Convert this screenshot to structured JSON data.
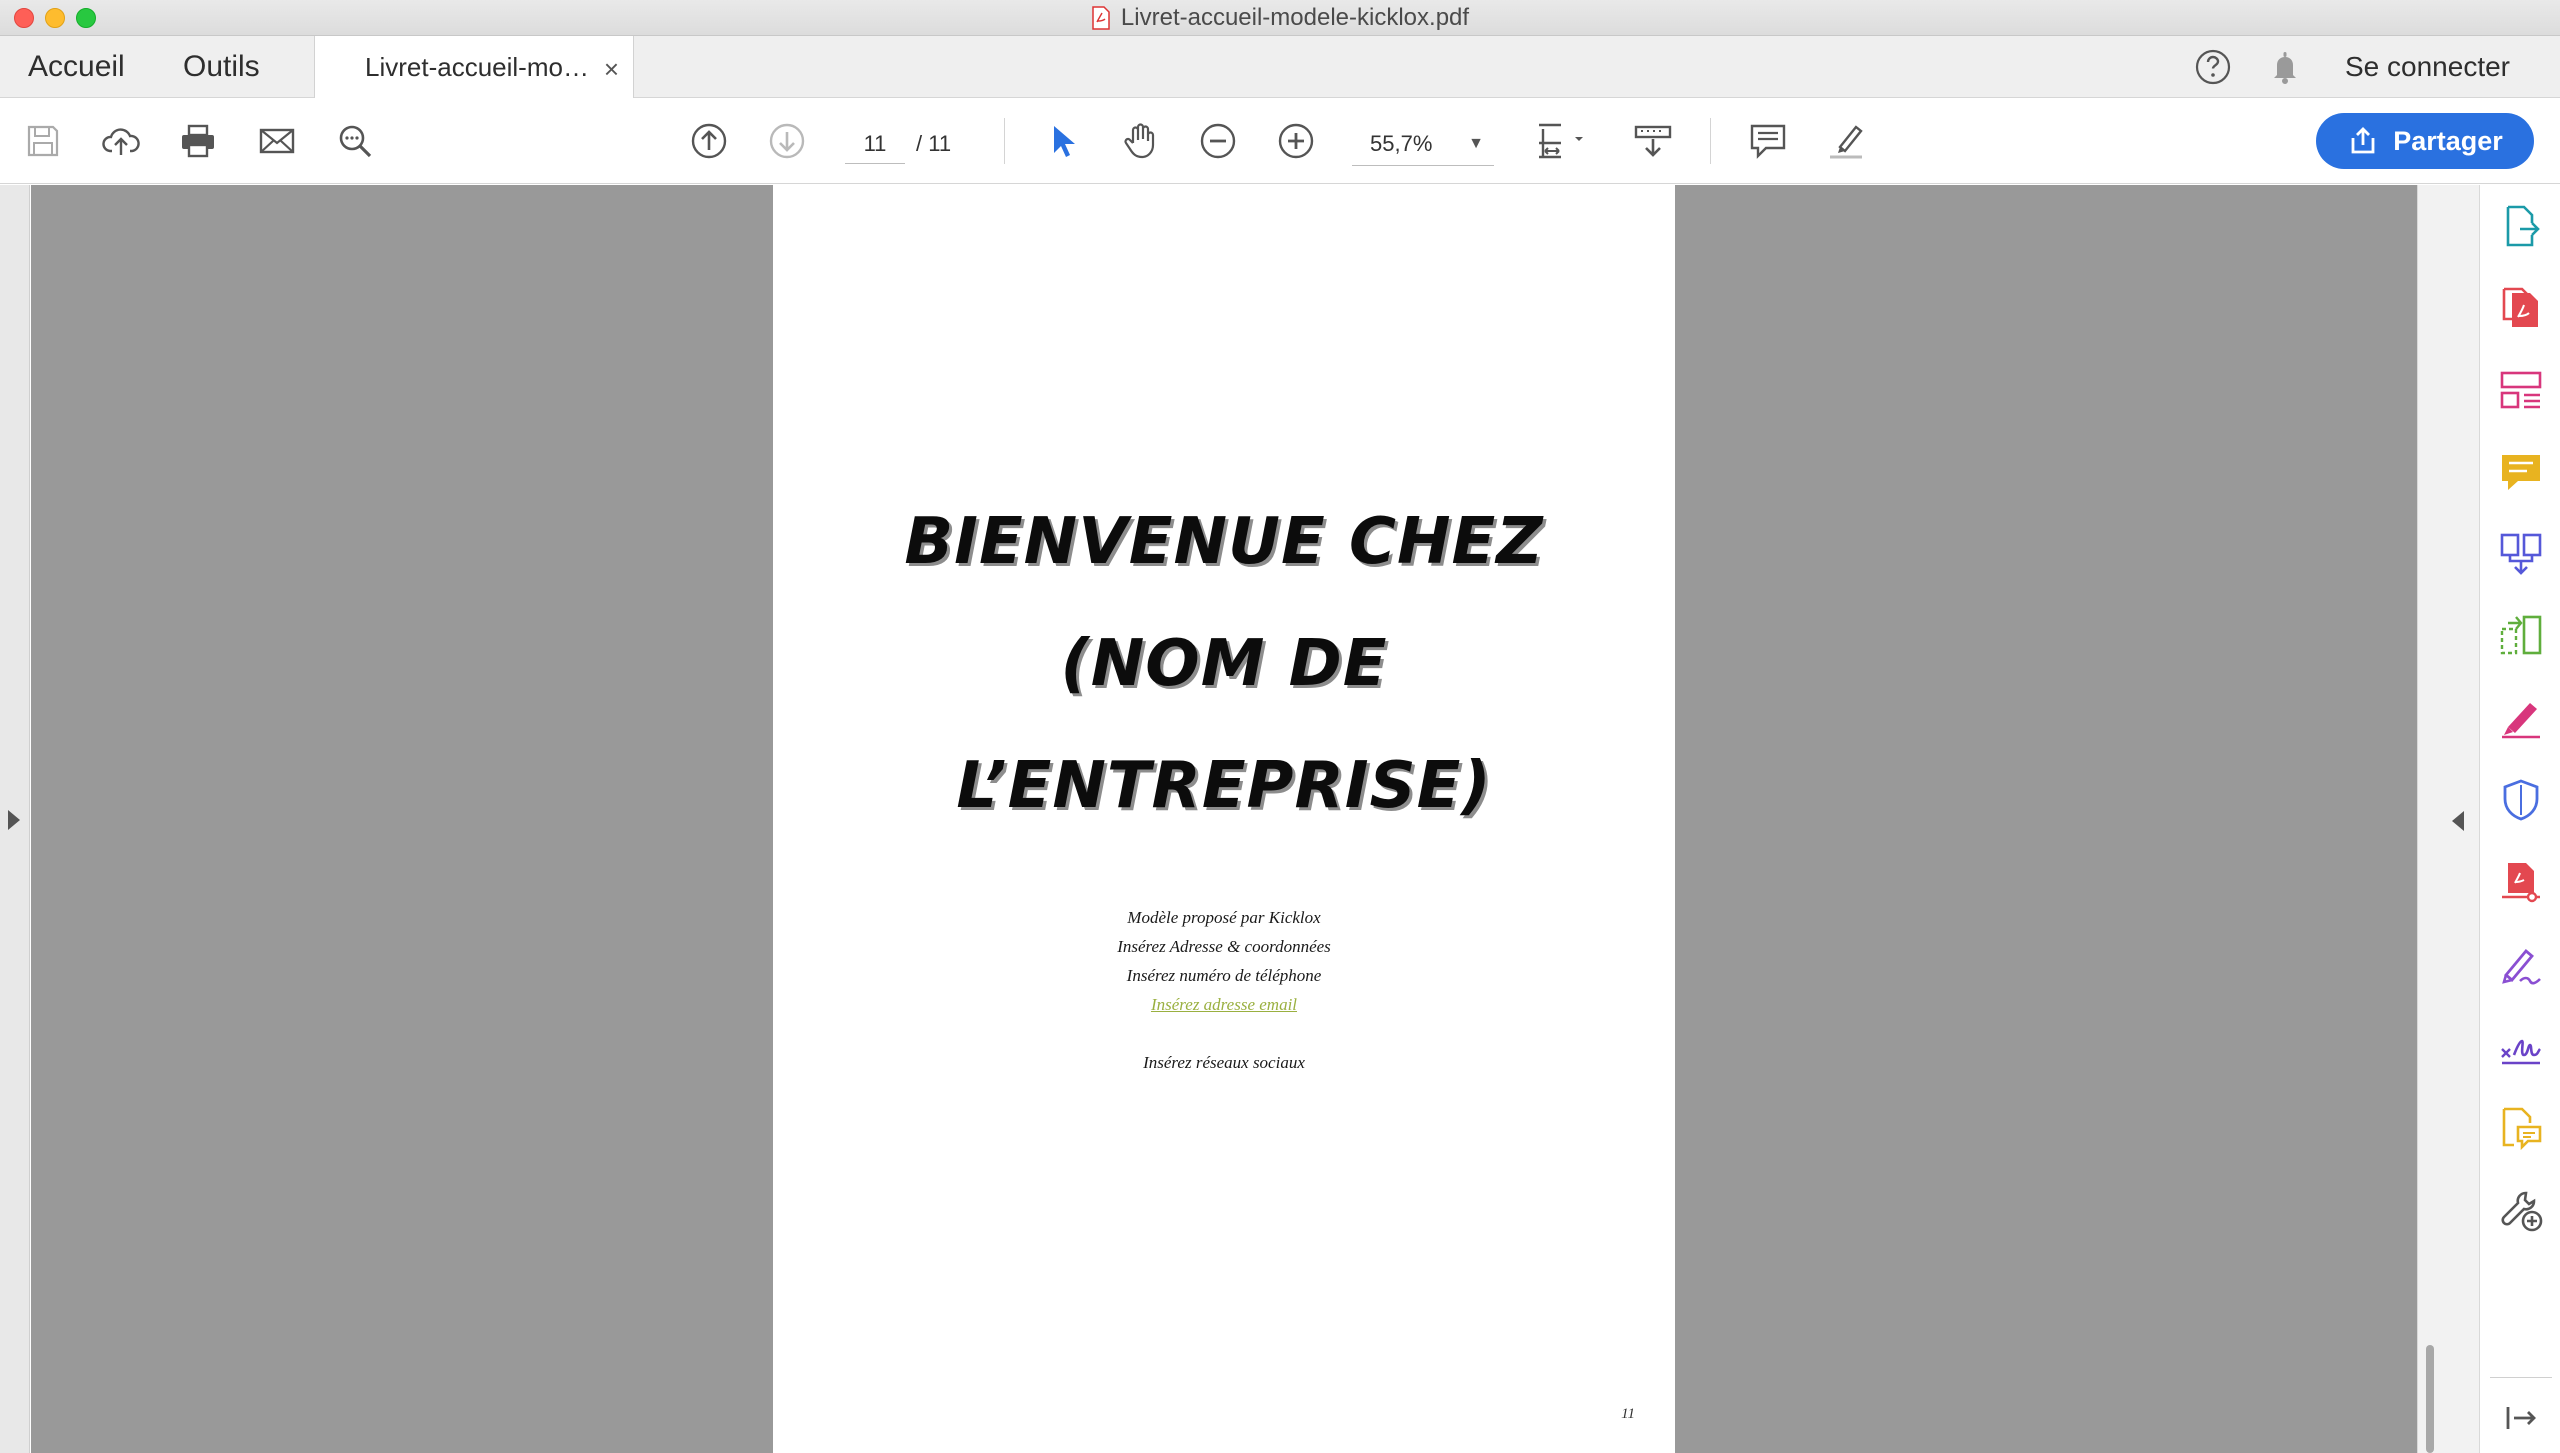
{
  "window": {
    "title": "Livret-accueil-modele-kicklox.pdf"
  },
  "tabs": {
    "home": "Accueil",
    "tools": "Outils",
    "document": "Livret-accueil-mo…",
    "close": "×"
  },
  "header": {
    "signin": "Se connecter"
  },
  "toolbar": {
    "current_page": "11",
    "page_total": "/ 11",
    "zoom": "55,7%",
    "share_label": "Partager"
  },
  "document": {
    "headline_lines": [
      "BIENVENUE CHEZ",
      "(NOM DE",
      "L’ENTREPRISE)"
    ],
    "info_lines": [
      "Modèle proposé par Kicklox",
      "Insérez Adresse & coordonnées",
      "Insérez numéro de téléphone"
    ],
    "email_line": "Insérez adresse email",
    "social_line": "Insérez réseaux sociaux",
    "page_number": "11"
  },
  "colors": {
    "accent_blue": "#2a71e0",
    "canvas_gray": "#999999",
    "email_green": "#9ab040"
  },
  "icons": {
    "toolbar": [
      "save-icon",
      "cloud-upload-icon",
      "print-icon",
      "mail-icon",
      "zoom-search-icon",
      "page-up-icon",
      "page-down-icon",
      "select-cursor-icon",
      "hand-icon",
      "zoom-out-icon",
      "zoom-in-icon",
      "page-fit-icon",
      "scroll-mode-icon",
      "comment-icon",
      "highlight-pen-icon"
    ],
    "rail": [
      "export-pdf-icon",
      "create-pdf-icon",
      "organize-pages-icon",
      "comment-tool-icon",
      "combine-files-icon",
      "edit-pdf-icon",
      "fill-sign-icon",
      "protect-icon",
      "pdf-compress-icon",
      "sign-icon",
      "signature-request-icon",
      "send-for-review-icon",
      "more-tools-icon",
      "collapse-rail-icon"
    ]
  }
}
